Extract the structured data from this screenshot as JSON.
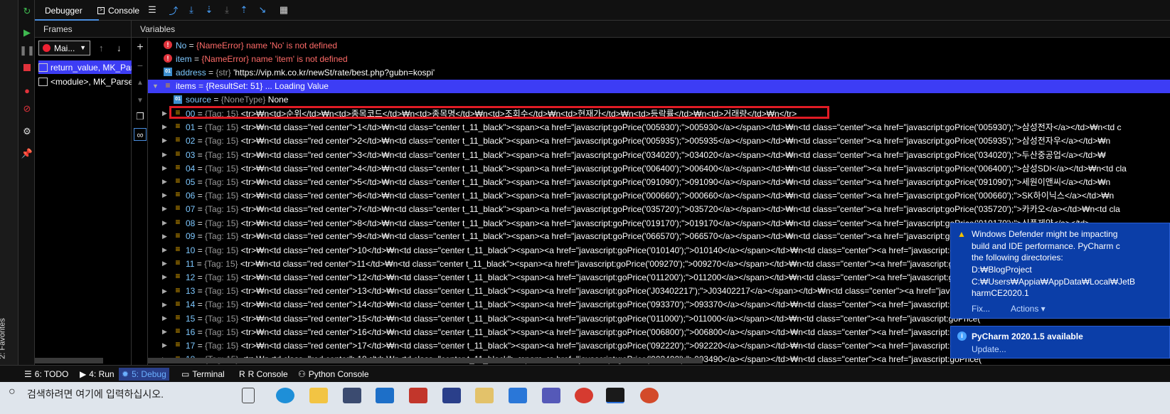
{
  "top": {
    "tab_debugger": "Debugger",
    "tab_console": "Console"
  },
  "frames": {
    "header": "Frames",
    "thread": "Mai...",
    "items": [
      {
        "label": "return_value, MK_Pars"
      },
      {
        "label": "<module>, MK_Parse"
      }
    ]
  },
  "vars": {
    "header": "Variables",
    "rows": [
      {
        "name": "No",
        "sep": " = ",
        "type": "{NameError}",
        "value": "name 'No' is not defined",
        "kind": "error"
      },
      {
        "name": "item",
        "sep": " = ",
        "type": "{NameError}",
        "value": "name 'item' is not defined",
        "kind": "error"
      },
      {
        "name": "address",
        "sep": " = ",
        "type": "{str}",
        "value": "'https://vip.mk.co.kr/newSt/rate/best.php?gubn=kospi'",
        "kind": "str"
      },
      {
        "name": "items",
        "sep": " = ",
        "type": "{ResultSet: 51}",
        "value": "... Loading Value",
        "kind": "list"
      },
      {
        "name": "source",
        "sep": " = ",
        "type": "{NoneType}",
        "value": "None",
        "kind": "str"
      },
      {
        "name": "00",
        "sep": " = ",
        "type": "{Tag: 15}",
        "value": "<tr>₩n<td>순위</td>₩n<td>종목코드</td>₩n<td>종목명</td>₩n<td>조회수</td>₩n<td>현재가</td>₩n<td>등락률</td>₩n<td>거래량</td>₩n</tr>",
        "kind": "list"
      },
      {
        "name": "01",
        "sep": " = ",
        "type": "{Tag: 15}",
        "value": "<tr>₩n<td class=\"red center\">1</td>₩n<td class=\"center t_11_black\"><span><a href=\"javascript:goPrice('005930');\">005930</a></span></td>₩n<td class=\"center\"><a href=\"javascript:goPrice('005930');\">삼성전자</a></td>₩n<td c",
        "kind": "list"
      },
      {
        "name": "02",
        "sep": " = ",
        "type": "{Tag: 15}",
        "value": "<tr>₩n<td class=\"red center\">2</td>₩n<td class=\"center t_11_black\"><span><a href=\"javascript:goPrice('005935');\">005935</a></span></td>₩n<td class=\"center\"><a href=\"javascript:goPrice('005935');\">삼성전자우</a></td>₩n",
        "kind": "list"
      },
      {
        "name": "03",
        "sep": " = ",
        "type": "{Tag: 15}",
        "value": "<tr>₩n<td class=\"red center\">3</td>₩n<td class=\"center t_11_black\"><span><a href=\"javascript:goPrice('034020');\">034020</a></span></td>₩n<td class=\"center\"><a href=\"javascript:goPrice('034020');\">두산중공업</a></td>₩",
        "kind": "list"
      },
      {
        "name": "04",
        "sep": " = ",
        "type": "{Tag: 15}",
        "value": "<tr>₩n<td class=\"red center\">4</td>₩n<td class=\"center t_11_black\"><span><a href=\"javascript:goPrice('006400');\">006400</a></span></td>₩n<td class=\"center\"><a href=\"javascript:goPrice('006400');\">삼성SDI</a></td>₩n<td cla",
        "kind": "list"
      },
      {
        "name": "05",
        "sep": " = ",
        "type": "{Tag: 15}",
        "value": "<tr>₩n<td class=\"red center\">5</td>₩n<td class=\"center t_11_black\"><span><a href=\"javascript:goPrice('091090');\">091090</a></span></td>₩n<td class=\"center\"><a href=\"javascript:goPrice('091090');\">세원이앤씨</a></td>₩n",
        "kind": "list"
      },
      {
        "name": "06",
        "sep": " = ",
        "type": "{Tag: 15}",
        "value": "<tr>₩n<td class=\"red center\">6</td>₩n<td class=\"center t_11_black\"><span><a href=\"javascript:goPrice('000660');\">000660</a></span></td>₩n<td class=\"center\"><a href=\"javascript:goPrice('000660');\">SK하이닉스</a></td>₩n",
        "kind": "list"
      },
      {
        "name": "07",
        "sep": " = ",
        "type": "{Tag: 15}",
        "value": "<tr>₩n<td class=\"red center\">7</td>₩n<td class=\"center t_11_black\"><span><a href=\"javascript:goPrice('035720');\">035720</a></span></td>₩n<td class=\"center\"><a href=\"javascript:goPrice('035720');\">카카오</a></td>₩n<td cla",
        "kind": "list"
      },
      {
        "name": "08",
        "sep": " = ",
        "type": "{Tag: 15}",
        "value": "<tr>₩n<td class=\"red center\">8</td>₩n<td class=\"center t_11_black\"><span><a href=\"javascript:goPrice('019170');\">019170</a></span></td>₩n<td class=\"center\"><a href=\"javascript:goPrice('019170');\">신풍제약</a></td>",
        "kind": "list"
      },
      {
        "name": "09",
        "sep": " = ",
        "type": "{Tag: 15}",
        "value": "<tr>₩n<td class=\"red center\">9</td>₩n<td class=\"center t_11_black\"><span><a href=\"javascript:goPrice('066570');\">066570</a></span></td>₩n<td class=\"center\"><a href=\"javascript:goPrice('066570');\">",
        "kind": "list"
      },
      {
        "name": "10",
        "sep": " = ",
        "type": "{Tag: 15}",
        "value": "<tr>₩n<td class=\"red center\">10</td>₩n<td class=\"center t_11_black\"><span><a href=\"javascript:goPrice('010140');\">010140</a></span></td>₩n<td class=\"center\"><a href=\"javascript:goPrice('",
        "kind": "list"
      },
      {
        "name": "11",
        "sep": " = ",
        "type": "{Tag: 15}",
        "value": "<tr>₩n<td class=\"red center\">11</td>₩n<td class=\"center t_11_black\"><span><a href=\"javascript:goPrice('009270');\">009270</a></span></td>₩n<td class=\"center\"><a href=\"javascript:goPrice('",
        "kind": "list"
      },
      {
        "name": "12",
        "sep": " = ",
        "type": "{Tag: 15}",
        "value": "<tr>₩n<td class=\"red center\">12</td>₩n<td class=\"center t_11_black\"><span><a href=\"javascript:goPrice('011200');\">011200</a></span></td>₩n<td class=\"center\"><a href=\"javascript:goPrice('",
        "kind": "list"
      },
      {
        "name": "13",
        "sep": " = ",
        "type": "{Tag: 15}",
        "value": "<tr>₩n<td class=\"red center\">13</td>₩n<td class=\"center t_11_black\"><span><a href=\"javascript:goPrice('J03402217');\">J03402217</a></span></td>₩n<td class=\"center\"><a href=\"javasc",
        "kind": "list"
      },
      {
        "name": "14",
        "sep": " = ",
        "type": "{Tag: 15}",
        "value": "<tr>₩n<td class=\"red center\">14</td>₩n<td class=\"center t_11_black\"><span><a href=\"javascript:goPrice('093370');\">093370</a></span></td>₩n<td class=\"center\"><a href=\"javascript:goPrice('",
        "kind": "list"
      },
      {
        "name": "15",
        "sep": " = ",
        "type": "{Tag: 15}",
        "value": "<tr>₩n<td class=\"red center\">15</td>₩n<td class=\"center t_11_black\"><span><a href=\"javascript:goPrice('011000');\">011000</a></span></td>₩n<td class=\"center\"><a href=\"javascript:goPrice('",
        "kind": "list"
      },
      {
        "name": "16",
        "sep": " = ",
        "type": "{Tag: 15}",
        "value": "<tr>₩n<td class=\"red center\">16</td>₩n<td class=\"center t_11_black\"><span><a href=\"javascript:goPrice('006800');\">006800</a></span></td>₩n<td class=\"center\"><a href=\"javascript:goPrice('",
        "kind": "list"
      },
      {
        "name": "17",
        "sep": " = ",
        "type": "{Tag: 15}",
        "value": "<tr>₩n<td class=\"red center\">17</td>₩n<td class=\"center t_11_black\"><span><a href=\"javascript:goPrice('092220');\">092220</a></span></td>₩n<td class=\"center\"><a href=\"javascript:goPrice('",
        "kind": "list"
      },
      {
        "name": "18",
        "sep": " = ",
        "type": "{Tag: 15}",
        "value": "<tr>₩n<td class=\"red center\">18</td>₩n<td class=\"center t_11_black\"><span><a href=\"javascript:goPrice('003490');\">003490</a></span></td>₩n<td class=\"center\"><a href=\"javascript:goPrice('",
        "kind": "list"
      }
    ]
  },
  "status": {
    "todo": "6: TODO",
    "run": "4: Run",
    "debug": "5: Debug",
    "terminal": "Terminal",
    "rconsole": "R Console",
    "python_console": "Python Console",
    "favorites": "2: Favorites"
  },
  "taskbar": {
    "search": "검색하려면 여기에 입력하십시오."
  },
  "notif_defender": {
    "line1": "Windows Defender might be impacting",
    "line2": "build and IDE performance. PyCharm c",
    "line3": "the following directories:",
    "line4": "D:₩BlogProject",
    "line5": "C:₩Users₩Appia₩AppData₩Local₩JetB",
    "line6": "harmCE2020.1",
    "fix": "Fix...",
    "actions": "Actions ▾"
  },
  "notif_update": {
    "title": "PyCharm 2020.1.5 available",
    "link": "Update..."
  },
  "colors": {
    "selection": "#3d3df5",
    "highlight_box": "#e01b24",
    "notification": "#0b3ea8"
  }
}
